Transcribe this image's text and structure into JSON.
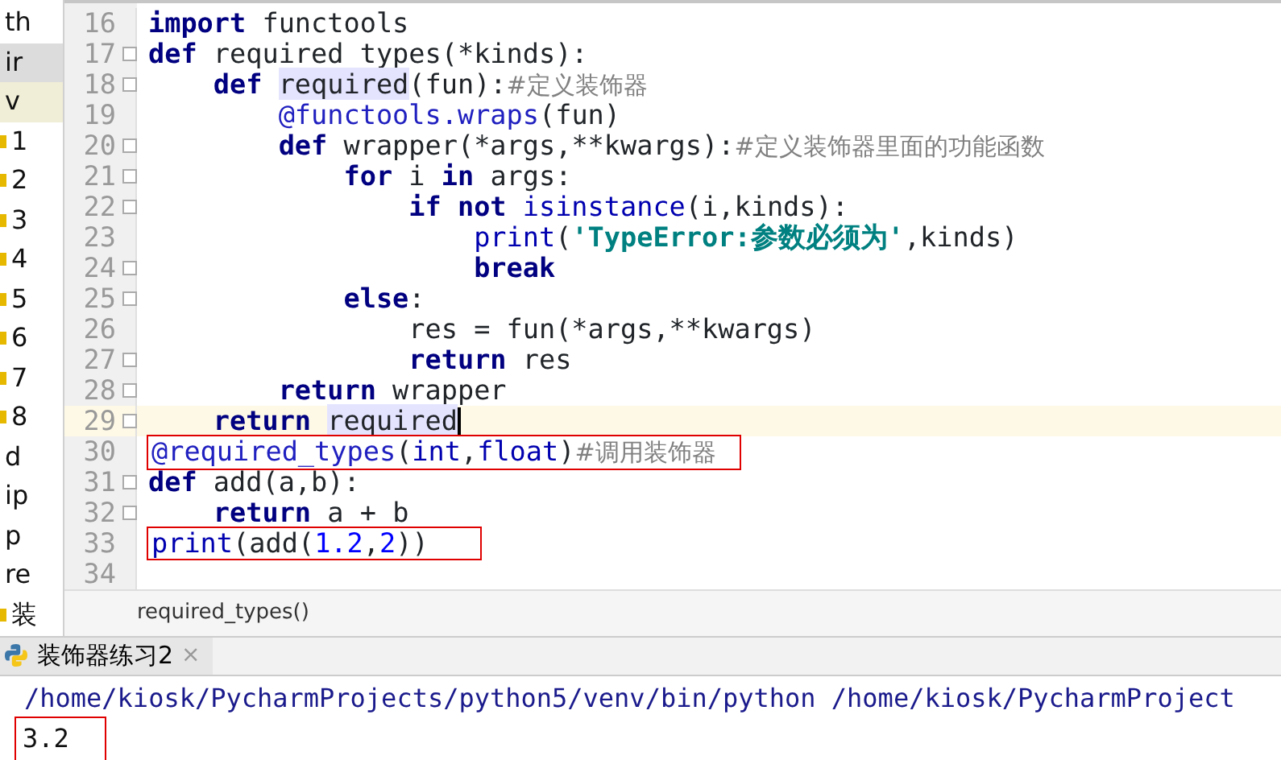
{
  "project_panel": {
    "items": [
      {
        "label": "th",
        "highlighted": false,
        "selected": false,
        "marker": false
      },
      {
        "label": "ir",
        "highlighted": true,
        "selected": false,
        "marker": false
      },
      {
        "label": "v",
        "highlighted": false,
        "selected": true,
        "marker": false
      },
      {
        "label": "1",
        "highlighted": false,
        "selected": false,
        "marker": true
      },
      {
        "label": "2",
        "highlighted": false,
        "selected": false,
        "marker": true
      },
      {
        "label": "3",
        "highlighted": false,
        "selected": false,
        "marker": true
      },
      {
        "label": "4",
        "highlighted": false,
        "selected": false,
        "marker": true
      },
      {
        "label": "5",
        "highlighted": false,
        "selected": false,
        "marker": true
      },
      {
        "label": "6",
        "highlighted": false,
        "selected": false,
        "marker": true
      },
      {
        "label": "7",
        "highlighted": false,
        "selected": false,
        "marker": true
      },
      {
        "label": "8",
        "highlighted": false,
        "selected": false,
        "marker": true
      },
      {
        "label": "d",
        "highlighted": false,
        "selected": false,
        "marker": false
      },
      {
        "label": "ip",
        "highlighted": false,
        "selected": false,
        "marker": false
      },
      {
        "label": "p",
        "highlighted": false,
        "selected": false,
        "marker": false
      },
      {
        "label": "re",
        "highlighted": false,
        "selected": false,
        "marker": false
      },
      {
        "label": "装",
        "highlighted": false,
        "selected": false,
        "marker": true
      }
    ]
  },
  "editor": {
    "lines": [
      {
        "number": "16",
        "fold": false,
        "current": false,
        "annotated": false,
        "tokens": [
          {
            "kind": "kw",
            "text": "import"
          },
          {
            "kind": "plain",
            "text": " functools"
          }
        ]
      },
      {
        "number": "17",
        "fold": true,
        "current": false,
        "annotated": false,
        "tokens": [
          {
            "kind": "kw",
            "text": "def"
          },
          {
            "kind": "plain",
            "text": " required_types(*kinds):"
          }
        ]
      },
      {
        "number": "18",
        "fold": true,
        "current": false,
        "annotated": false,
        "tokens": [
          {
            "kind": "kw",
            "text": "    def "
          },
          {
            "kind": "ref",
            "text": "required"
          },
          {
            "kind": "plain",
            "text": "(fun):"
          },
          {
            "kind": "comment",
            "text": "#定义装饰器"
          }
        ]
      },
      {
        "number": "19",
        "fold": false,
        "current": false,
        "annotated": false,
        "tokens": [
          {
            "kind": "deco",
            "text": "        @functools.wraps"
          },
          {
            "kind": "plain",
            "text": "(fun)"
          }
        ]
      },
      {
        "number": "20",
        "fold": true,
        "current": false,
        "annotated": false,
        "tokens": [
          {
            "kind": "kw",
            "text": "        def"
          },
          {
            "kind": "plain",
            "text": " wrapper(*args,**kwargs):"
          },
          {
            "kind": "comment",
            "text": "#定义装饰器里面的功能函数"
          }
        ]
      },
      {
        "number": "21",
        "fold": true,
        "current": false,
        "annotated": false,
        "tokens": [
          {
            "kind": "kw",
            "text": "            for"
          },
          {
            "kind": "plain",
            "text": " i "
          },
          {
            "kind": "kw",
            "text": "in"
          },
          {
            "kind": "plain",
            "text": " args:"
          }
        ]
      },
      {
        "number": "22",
        "fold": true,
        "current": false,
        "annotated": false,
        "tokens": [
          {
            "kind": "kw",
            "text": "                if not "
          },
          {
            "kind": "builtin",
            "text": "isinstance"
          },
          {
            "kind": "plain",
            "text": "(i,kinds):"
          }
        ]
      },
      {
        "number": "23",
        "fold": false,
        "current": false,
        "annotated": false,
        "tokens": [
          {
            "kind": "builtin",
            "text": "                    print"
          },
          {
            "kind": "plain",
            "text": "("
          },
          {
            "kind": "string",
            "text": "'TypeError:参数必须为'"
          },
          {
            "kind": "plain",
            "text": ",kinds)"
          }
        ]
      },
      {
        "number": "24",
        "fold": true,
        "current": false,
        "annotated": false,
        "tokens": [
          {
            "kind": "kw",
            "text": "                    break"
          }
        ]
      },
      {
        "number": "25",
        "fold": true,
        "current": false,
        "annotated": false,
        "tokens": [
          {
            "kind": "kw",
            "text": "            else"
          },
          {
            "kind": "plain",
            "text": ":"
          }
        ]
      },
      {
        "number": "26",
        "fold": false,
        "current": false,
        "annotated": false,
        "tokens": [
          {
            "kind": "plain",
            "text": "                res = fun(*args,**kwargs)"
          }
        ]
      },
      {
        "number": "27",
        "fold": true,
        "current": false,
        "annotated": false,
        "tokens": [
          {
            "kind": "kw",
            "text": "                return"
          },
          {
            "kind": "plain",
            "text": " res"
          }
        ]
      },
      {
        "number": "28",
        "fold": true,
        "current": false,
        "annotated": false,
        "tokens": [
          {
            "kind": "kw",
            "text": "        return"
          },
          {
            "kind": "plain",
            "text": " wrapper"
          }
        ]
      },
      {
        "number": "29",
        "fold": true,
        "current": true,
        "annotated": false,
        "tokens": [
          {
            "kind": "kw",
            "text": "    return "
          },
          {
            "kind": "ref",
            "text": "required"
          }
        ]
      },
      {
        "number": "30",
        "fold": false,
        "current": false,
        "annotated": true,
        "tokens": [
          {
            "kind": "deco",
            "text": "@required_types"
          },
          {
            "kind": "plain",
            "text": "("
          },
          {
            "kind": "builtin",
            "text": "int"
          },
          {
            "kind": "plain",
            "text": ","
          },
          {
            "kind": "builtin",
            "text": "float"
          },
          {
            "kind": "plain",
            "text": ")"
          },
          {
            "kind": "comment",
            "text": "#调用装饰器"
          }
        ]
      },
      {
        "number": "31",
        "fold": true,
        "current": false,
        "annotated": false,
        "tokens": [
          {
            "kind": "kw",
            "text": "def"
          },
          {
            "kind": "plain",
            "text": " add(a,b):"
          }
        ]
      },
      {
        "number": "32",
        "fold": true,
        "current": false,
        "annotated": false,
        "tokens": [
          {
            "kind": "kw",
            "text": "    return"
          },
          {
            "kind": "plain",
            "text": " a + b"
          }
        ]
      },
      {
        "number": "33",
        "fold": false,
        "current": false,
        "annotated": true,
        "tokens": [
          {
            "kind": "builtin",
            "text": "print"
          },
          {
            "kind": "plain",
            "text": "(add("
          },
          {
            "kind": "number",
            "text": "1.2"
          },
          {
            "kind": "plain",
            "text": ","
          },
          {
            "kind": "number",
            "text": "2"
          },
          {
            "kind": "plain",
            "text": "))"
          }
        ]
      },
      {
        "number": "34",
        "fold": false,
        "current": false
      }
    ]
  },
  "breadcrumb": "required_types()",
  "run_tab": {
    "label": "装饰器练习2",
    "close": "×"
  },
  "console": {
    "lines": [
      {
        "kind": "command",
        "text": "/home/kiosk/PycharmProjects/python5/venv/bin/python /home/kiosk/PycharmProject",
        "annotated": false
      },
      {
        "kind": "output",
        "text": "3.2",
        "annotated": true
      }
    ]
  }
}
